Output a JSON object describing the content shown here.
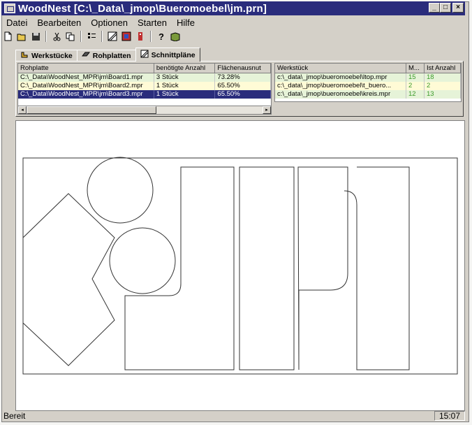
{
  "window": {
    "title": "WoodNest [C:\\_Data\\_jmop\\Bueromoebel\\jm.prn]",
    "btn_minimize": "_",
    "btn_maximize": "□",
    "btn_close": "×"
  },
  "menu": [
    "Datei",
    "Bearbeiten",
    "Optionen",
    "Starten",
    "Hilfe"
  ],
  "toolbar_icons": [
    "new-icon",
    "open-icon",
    "save-icon",
    "cut-icon",
    "copy-icon",
    "list-icon",
    "nest-icon",
    "color-icon",
    "info-icon",
    "help-icon",
    "book-icon"
  ],
  "tabs": [
    {
      "label": "Werkstücke",
      "icon": "workpiece-icon"
    },
    {
      "label": "Rohplatten",
      "icon": "board-icon"
    },
    {
      "label": "Schnittpläne",
      "icon": "cutplan-icon",
      "active": true
    }
  ],
  "boards_table": {
    "headers": [
      "Rohplatte",
      "benötigte Anzahl",
      "Flächenausnut"
    ],
    "rows": [
      {
        "path": "C:\\_Data\\WoodNest_MPR\\jm\\Board1.mpr",
        "count": "3 Stück",
        "usage": "73.28%"
      },
      {
        "path": "C:\\_Data\\WoodNest_MPR\\jm\\Board2.mpr",
        "count": "1 Stück",
        "usage": "65.50%"
      },
      {
        "path": "C:\\_Data\\WoodNest_MPR\\jm\\Board3.mpr",
        "count": "1 Stück",
        "usage": "65.50%"
      }
    ],
    "selected_index": 2
  },
  "parts_table": {
    "headers": [
      "Werkstück",
      "M...",
      "Ist Anzahl"
    ],
    "rows": [
      {
        "path": "c:\\_data\\_jmop\\bueromoebel\\ltop.mpr",
        "m": "15",
        "ist": "18"
      },
      {
        "path": "c:\\_data\\_jmop\\bueromoebel\\t_buero...",
        "m": "2",
        "ist": "2"
      },
      {
        "path": "c:\\_data\\_jmop\\bueromoebel\\kreis.mpr",
        "m": "12",
        "ist": "13"
      }
    ]
  },
  "status": {
    "left": "Bereit",
    "time": "15:07"
  }
}
